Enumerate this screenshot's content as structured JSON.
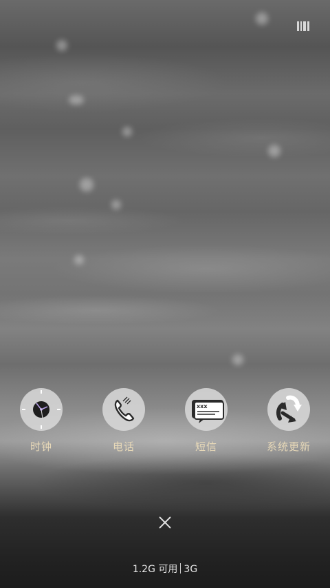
{
  "apps": [
    {
      "label": "时钟",
      "icon": "clock-icon"
    },
    {
      "label": "电话",
      "icon": "phone-icon"
    },
    {
      "label": "短信",
      "icon": "message-icon"
    },
    {
      "label": "系统更新",
      "icon": "system-update-icon"
    }
  ],
  "message_icon_text": "xxx",
  "memory": {
    "available": "1.2G 可用",
    "total": "3G"
  },
  "colors": {
    "label": "#e8d9b8",
    "icon_bg": "#d7d7d7",
    "icon_fg": "#2a2a2a"
  }
}
